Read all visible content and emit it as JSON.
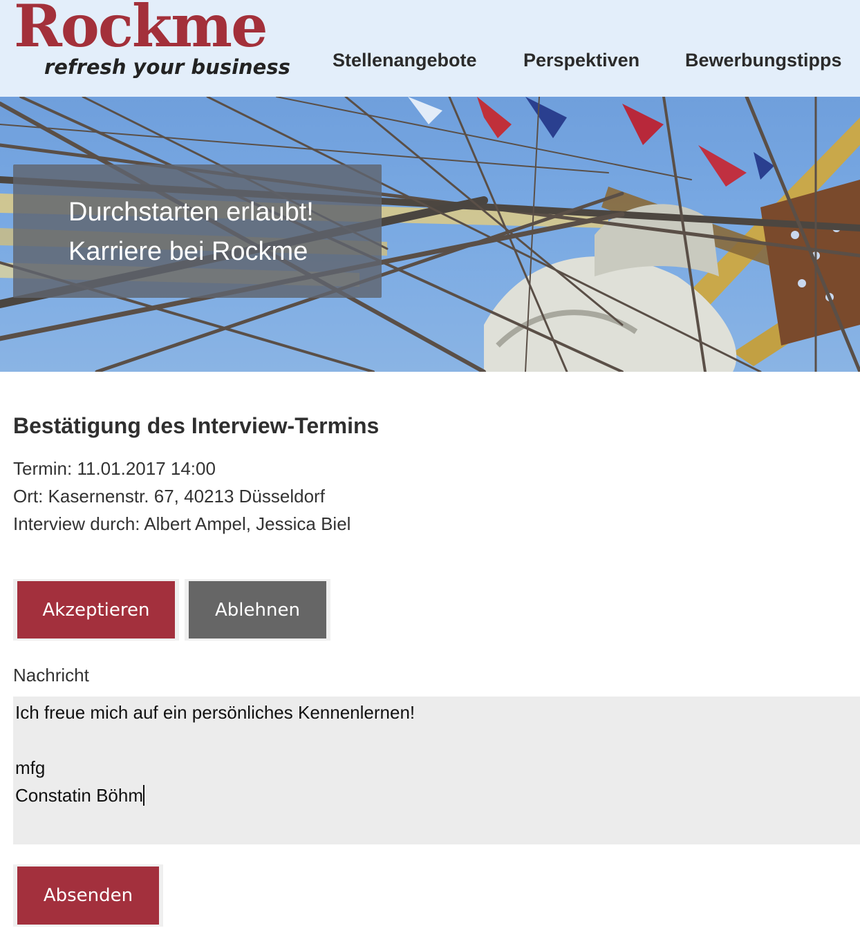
{
  "brand": {
    "name": "Rockme",
    "tagline": "refresh your business",
    "color": "#a3303a"
  },
  "nav": {
    "items": [
      "Stellenangebote",
      "Perspektiven",
      "Bewerbungstipps"
    ]
  },
  "hero": {
    "line1": "Durchstarten erlaubt!",
    "line2": "Karriere bei Rockme"
  },
  "interview": {
    "title": "Bestätigung des Interview-Termins",
    "termin": "Termin: 11.01.2017 14:00",
    "ort": "Ort: Kasernenstr. 67, 40213 Düsseldorf",
    "interviewer": "Interview durch: Albert Ampel, Jessica Biel"
  },
  "actions": {
    "accept_label": "Akzeptieren",
    "reject_label": "Ablehnen",
    "accept_color": "#a3303d",
    "reject_color": "#666666"
  },
  "message": {
    "label": "Nachricht",
    "lines": [
      "Ich freue mich auf ein persönliches Kennenlernen!",
      "",
      "mfg",
      "Constatin Böhm"
    ]
  },
  "submit": {
    "label": "Absenden"
  }
}
